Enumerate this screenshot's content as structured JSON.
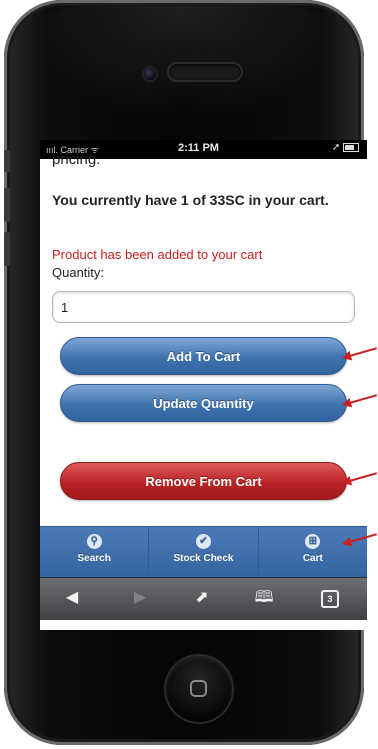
{
  "status_bar": {
    "carrier": "ıııl. Carrier ᯤ",
    "time": "2:11 PM",
    "right": "➚"
  },
  "page": {
    "clipped_text": "pricing.",
    "cart_message": "You currently have 1 of 33SC in your cart.",
    "added_message": "Product has been added to your cart",
    "quantity_label": "Quantity:",
    "quantity_value": "1"
  },
  "buttons": {
    "add_to_cart": "Add To Cart",
    "update_quantity": "Update Quantity",
    "remove_from_cart": "Remove From Cart"
  },
  "tabbar": {
    "items": [
      {
        "label": "Search",
        "icon": "search-icon",
        "glyph": "⚲"
      },
      {
        "label": "Stock Check",
        "icon": "check-icon",
        "glyph": "✔"
      },
      {
        "label": "Cart",
        "icon": "grid-icon",
        "glyph": "⊞"
      }
    ]
  },
  "browser_toolbar": {
    "back": "◀",
    "forward": "▶",
    "share": "⬈",
    "bookmarks": "🕮",
    "tabs_count": "3"
  },
  "colors": {
    "accent_blue": "#3f72ad",
    "danger_red": "#b92325",
    "error_text": "#c8201e",
    "tabbar_blue": "#3464a2"
  }
}
